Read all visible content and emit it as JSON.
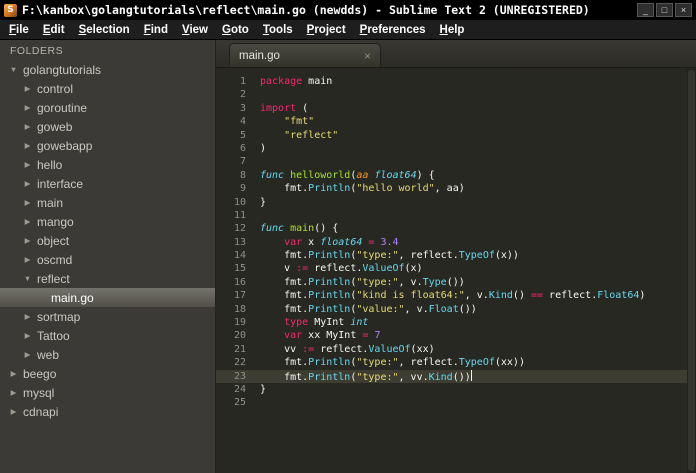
{
  "window": {
    "title": "F:\\kanbox\\golangtutorials\\reflect\\main.go (newdds) - Sublime Text 2 (UNREGISTERED)",
    "controls": [
      "minimize",
      "maximize",
      "close"
    ]
  },
  "icons": {
    "app": "S",
    "minimize": "_",
    "maximize": "□",
    "close": "×",
    "tab_close": "×",
    "folder_expanded": "▼",
    "folder_collapsed": "▶"
  },
  "menu": {
    "items": [
      {
        "label": "File",
        "accel": 0
      },
      {
        "label": "Edit",
        "accel": 0
      },
      {
        "label": "Selection",
        "accel": 0
      },
      {
        "label": "Find",
        "accel": 0
      },
      {
        "label": "View",
        "accel": 0
      },
      {
        "label": "Goto",
        "accel": 0
      },
      {
        "label": "Tools",
        "accel": 0
      },
      {
        "label": "Project",
        "accel": 0
      },
      {
        "label": "Preferences",
        "accel": 0
      },
      {
        "label": "Help",
        "accel": 0
      }
    ]
  },
  "sidebar": {
    "header": "FOLDERS",
    "items": [
      {
        "label": "golangtutorials",
        "depth": 0,
        "state": "expanded",
        "selected": false
      },
      {
        "label": "control",
        "depth": 1,
        "state": "collapsed",
        "selected": false
      },
      {
        "label": "goroutine",
        "depth": 1,
        "state": "collapsed",
        "selected": false
      },
      {
        "label": "goweb",
        "depth": 1,
        "state": "collapsed",
        "selected": false
      },
      {
        "label": "gowebapp",
        "depth": 1,
        "state": "collapsed",
        "selected": false
      },
      {
        "label": "hello",
        "depth": 1,
        "state": "collapsed",
        "selected": false
      },
      {
        "label": "interface",
        "depth": 1,
        "state": "collapsed",
        "selected": false
      },
      {
        "label": "main",
        "depth": 1,
        "state": "collapsed",
        "selected": false
      },
      {
        "label": "mango",
        "depth": 1,
        "state": "collapsed",
        "selected": false
      },
      {
        "label": "object",
        "depth": 1,
        "state": "collapsed",
        "selected": false
      },
      {
        "label": "oscmd",
        "depth": 1,
        "state": "collapsed",
        "selected": false
      },
      {
        "label": "reflect",
        "depth": 1,
        "state": "expanded",
        "selected": false
      },
      {
        "label": "main.go",
        "depth": 2,
        "state": "file",
        "selected": true
      },
      {
        "label": "sortmap",
        "depth": 1,
        "state": "collapsed",
        "selected": false
      },
      {
        "label": "Tattoo",
        "depth": 1,
        "state": "collapsed",
        "selected": false
      },
      {
        "label": "web",
        "depth": 1,
        "state": "collapsed",
        "selected": false
      },
      {
        "label": "beego",
        "depth": 0,
        "state": "collapsed",
        "selected": false
      },
      {
        "label": "mysql",
        "depth": 0,
        "state": "collapsed",
        "selected": false
      },
      {
        "label": "cdnapi",
        "depth": 0,
        "state": "collapsed",
        "selected": false
      }
    ]
  },
  "tabs": [
    {
      "label": "main.go",
      "active": true
    }
  ],
  "editor": {
    "current_line": 23,
    "cursor_line": 23,
    "lines": [
      {
        "n": 1,
        "tok": [
          [
            "package",
            "k"
          ],
          [
            " main",
            "w"
          ]
        ]
      },
      {
        "n": 2,
        "tok": []
      },
      {
        "n": 3,
        "tok": [
          [
            "import",
            "k"
          ],
          [
            " (",
            "w"
          ]
        ]
      },
      {
        "n": 4,
        "tok": [
          [
            "    ",
            "w"
          ],
          [
            "\"fmt\"",
            "q"
          ]
        ]
      },
      {
        "n": 5,
        "tok": [
          [
            "    ",
            "w"
          ],
          [
            "\"reflect\"",
            "q"
          ]
        ]
      },
      {
        "n": 6,
        "tok": [
          [
            ")",
            "w"
          ]
        ]
      },
      {
        "n": 7,
        "tok": []
      },
      {
        "n": 8,
        "tok": [
          [
            "func",
            "s"
          ],
          [
            " ",
            "w"
          ],
          [
            "helloworld",
            "f"
          ],
          [
            "(",
            "w"
          ],
          [
            "aa",
            "p"
          ],
          [
            " ",
            "w"
          ],
          [
            "float64",
            "s"
          ],
          [
            ") {",
            "w"
          ]
        ]
      },
      {
        "n": 9,
        "tok": [
          [
            "    fmt.",
            "w"
          ],
          [
            "Println",
            "c"
          ],
          [
            "(",
            "w"
          ],
          [
            "\"hello world\"",
            "q"
          ],
          [
            ", aa)",
            "w"
          ]
        ]
      },
      {
        "n": 10,
        "tok": [
          [
            "}",
            "w"
          ]
        ]
      },
      {
        "n": 11,
        "tok": []
      },
      {
        "n": 12,
        "tok": [
          [
            "func",
            "s"
          ],
          [
            " ",
            "w"
          ],
          [
            "main",
            "f"
          ],
          [
            "() {",
            "w"
          ]
        ]
      },
      {
        "n": 13,
        "tok": [
          [
            "    ",
            "w"
          ],
          [
            "var",
            "k"
          ],
          [
            " x ",
            "w"
          ],
          [
            "float64",
            "s"
          ],
          [
            " ",
            "w"
          ],
          [
            "=",
            "k"
          ],
          [
            " ",
            "w"
          ],
          [
            "3.4",
            "n"
          ]
        ]
      },
      {
        "n": 14,
        "tok": [
          [
            "    fmt.",
            "w"
          ],
          [
            "Println",
            "c"
          ],
          [
            "(",
            "w"
          ],
          [
            "\"type:\"",
            "q"
          ],
          [
            ", reflect.",
            "w"
          ],
          [
            "TypeOf",
            "c"
          ],
          [
            "(x))",
            "w"
          ]
        ]
      },
      {
        "n": 15,
        "tok": [
          [
            "    v ",
            "w"
          ],
          [
            ":=",
            "k"
          ],
          [
            " reflect.",
            "w"
          ],
          [
            "ValueOf",
            "c"
          ],
          [
            "(x)",
            "w"
          ]
        ]
      },
      {
        "n": 16,
        "tok": [
          [
            "    fmt.",
            "w"
          ],
          [
            "Println",
            "c"
          ],
          [
            "(",
            "w"
          ],
          [
            "\"type:\"",
            "q"
          ],
          [
            ", v.",
            "w"
          ],
          [
            "Type",
            "c"
          ],
          [
            "())",
            "w"
          ]
        ]
      },
      {
        "n": 17,
        "tok": [
          [
            "    fmt.",
            "w"
          ],
          [
            "Println",
            "c"
          ],
          [
            "(",
            "w"
          ],
          [
            "\"kind is float64:\"",
            "q"
          ],
          [
            ", v.",
            "w"
          ],
          [
            "Kind",
            "c"
          ],
          [
            "() ",
            "w"
          ],
          [
            "==",
            "k"
          ],
          [
            " reflect.",
            "w"
          ],
          [
            "Float64",
            "c"
          ],
          [
            ")",
            "w"
          ]
        ]
      },
      {
        "n": 18,
        "tok": [
          [
            "    fmt.",
            "w"
          ],
          [
            "Println",
            "c"
          ],
          [
            "(",
            "w"
          ],
          [
            "\"value:\"",
            "q"
          ],
          [
            ", v.",
            "w"
          ],
          [
            "Float",
            "c"
          ],
          [
            "())",
            "w"
          ]
        ]
      },
      {
        "n": 19,
        "tok": [
          [
            "    ",
            "w"
          ],
          [
            "type",
            "k"
          ],
          [
            " MyInt ",
            "w"
          ],
          [
            "int",
            "s"
          ]
        ]
      },
      {
        "n": 20,
        "tok": [
          [
            "    ",
            "w"
          ],
          [
            "var",
            "k"
          ],
          [
            " xx MyInt ",
            "w"
          ],
          [
            "=",
            "k"
          ],
          [
            " ",
            "w"
          ],
          [
            "7",
            "n"
          ]
        ]
      },
      {
        "n": 21,
        "tok": [
          [
            "    vv ",
            "w"
          ],
          [
            ":=",
            "k"
          ],
          [
            " reflect.",
            "w"
          ],
          [
            "ValueOf",
            "c"
          ],
          [
            "(xx)",
            "w"
          ]
        ]
      },
      {
        "n": 22,
        "tok": [
          [
            "    fmt.",
            "w"
          ],
          [
            "Println",
            "c"
          ],
          [
            "(",
            "w"
          ],
          [
            "\"type:\"",
            "q"
          ],
          [
            ", reflect.",
            "w"
          ],
          [
            "TypeOf",
            "c"
          ],
          [
            "(xx))",
            "w"
          ]
        ]
      },
      {
        "n": 23,
        "tok": [
          [
            "    fmt.",
            "w"
          ],
          [
            "Println",
            "c"
          ],
          [
            "(",
            "w"
          ],
          [
            "\"type:\"",
            "q"
          ],
          [
            ", vv.",
            "w"
          ],
          [
            "Kind",
            "c"
          ],
          [
            "())",
            "w"
          ]
        ]
      },
      {
        "n": 24,
        "tok": [
          [
            "}",
            "w"
          ]
        ]
      },
      {
        "n": 25,
        "tok": []
      }
    ]
  },
  "colors": {
    "keyword": "#F92672",
    "storage_type": "#66D9EF",
    "function_name": "#A6E22E",
    "support_call": "#66D9EF",
    "string": "#E6DB74",
    "number": "#AE81FF",
    "parameter": "#FD971F",
    "text": "#F8F8F2",
    "editor_background": "#272822",
    "current_line": "#3E3D32",
    "sidebar_background": "#3B3A36",
    "titlebar_background": "#000000"
  }
}
